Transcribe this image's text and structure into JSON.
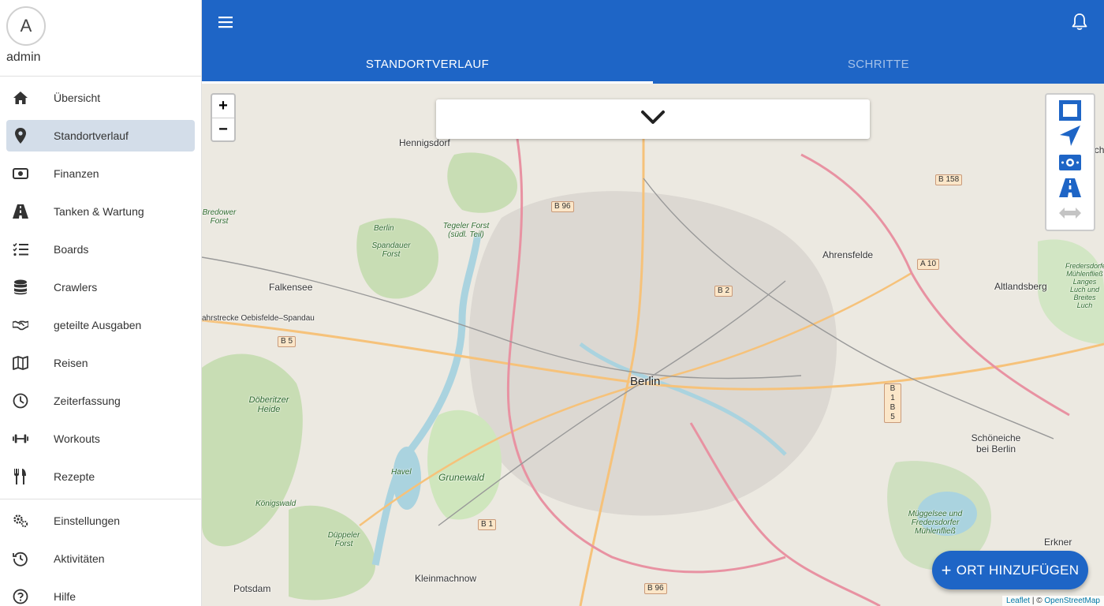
{
  "user": {
    "avatar_letter": "A",
    "name": "admin"
  },
  "nav": {
    "items": [
      {
        "label": "Übersicht",
        "icon": "home-icon"
      },
      {
        "label": "Standortverlauf",
        "icon": "location-pin-icon",
        "active": true
      },
      {
        "label": "Finanzen",
        "icon": "money-icon"
      },
      {
        "label": "Tanken & Wartung",
        "icon": "road-icon"
      },
      {
        "label": "Boards",
        "icon": "checklist-icon"
      },
      {
        "label": "Crawlers",
        "icon": "database-icon"
      },
      {
        "label": "geteilte Ausgaben",
        "icon": "handshake-icon"
      },
      {
        "label": "Reisen",
        "icon": "map-icon"
      },
      {
        "label": "Zeiterfassung",
        "icon": "clock-icon"
      },
      {
        "label": "Workouts",
        "icon": "dumbbell-icon"
      },
      {
        "label": "Rezepte",
        "icon": "utensils-icon"
      }
    ],
    "secondary": [
      {
        "label": "Einstellungen",
        "icon": "gears-icon"
      },
      {
        "label": "Aktivitäten",
        "icon": "history-icon"
      },
      {
        "label": "Hilfe",
        "icon": "help-icon"
      }
    ]
  },
  "tabs": [
    {
      "label": "STANDORTVERLAUF",
      "active": true
    },
    {
      "label": "SCHRITTE",
      "active": false
    }
  ],
  "map": {
    "zoom_in": "+",
    "zoom_out": "−",
    "places": {
      "berlin": "Berlin",
      "hennigsdorf": "Hennigsdorf",
      "falkensee": "Falkensee",
      "ahrensfelde": "Ahrensfelde",
      "altlandsberg": "Altlandsberg",
      "werneuchen": "Werneuch",
      "schoeneiche": "Schöneiche bei Berlin",
      "erkner": "Erkner",
      "potsdam": "Potsdam",
      "kleinmachnow": "Kleinmachnow",
      "grunewald": "Grunewald",
      "doeberitzer": "Döberitzer Heide",
      "spandauer": "Spandauer Forst",
      "tegeler": "Tegeler Forst (südl. Teil)",
      "bredower": "Bredower Forst",
      "koenigswald": "Königswald",
      "dueppeler": "Düppeler Forst",
      "muggelsee": "Müggelsee und Fredersdorfer Mühlenfließ",
      "fredersdorfer": "Fredersdorfer Mühlenfließ Langes Luch und Breites Luch",
      "havel": "Havel",
      "berlin_river": "Berlin",
      "strecke": "ahrstrecke Oebisfelde–Spandau"
    },
    "shields": {
      "b96_top": "B 96",
      "b158": "B 158",
      "b2": "B 2",
      "a10": "A 10",
      "b5": "B 5",
      "b1b5": "B 1 B 5",
      "b1": "B 1",
      "b96_bottom": "B 96"
    },
    "attribution": {
      "leaflet": "Leaflet",
      "separator": " | © ",
      "osm": "OpenStreetMap"
    }
  },
  "fab": {
    "plus": "+",
    "label": "ORT HINZUFÜGEN"
  },
  "colors": {
    "primary": "#1e65c6",
    "active_nav": "#d3dde9"
  }
}
